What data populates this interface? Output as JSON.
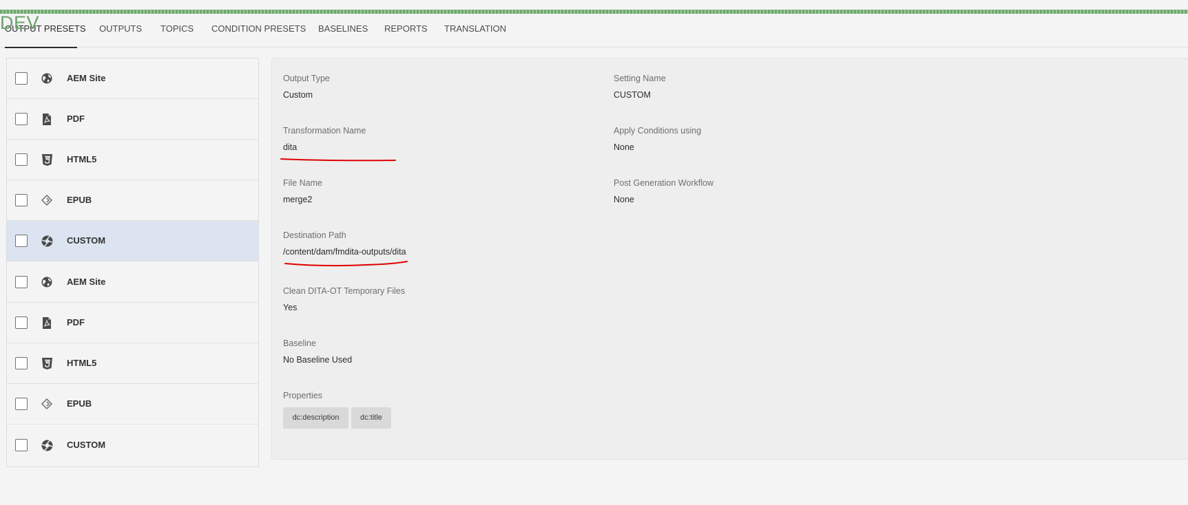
{
  "env_badge": "DEV",
  "tabs": [
    {
      "label": "OUTPUT PRESETS",
      "active": true
    },
    {
      "label": "OUTPUTS"
    },
    {
      "label": "TOPICS"
    },
    {
      "label": "CONDITION PRESETS"
    },
    {
      "label": "BASELINES"
    },
    {
      "label": "REPORTS"
    },
    {
      "label": "TRANSLATION"
    }
  ],
  "presets": [
    {
      "label": "AEM Site",
      "icon": "globe-icon"
    },
    {
      "label": "PDF",
      "icon": "pdf-file-icon"
    },
    {
      "label": "HTML5",
      "icon": "html5-icon"
    },
    {
      "label": "EPUB",
      "icon": "epub-icon"
    },
    {
      "label": "CUSTOM",
      "icon": "aperture-icon",
      "selected": true
    },
    {
      "label": "AEM Site",
      "icon": "globe-icon"
    },
    {
      "label": "PDF",
      "icon": "pdf-file-icon"
    },
    {
      "label": "HTML5",
      "icon": "html5-icon"
    },
    {
      "label": "EPUB",
      "icon": "epub-icon"
    },
    {
      "label": "CUSTOM",
      "icon": "aperture-icon"
    }
  ],
  "details": {
    "output_type": {
      "label": "Output Type",
      "value": "Custom"
    },
    "setting_name": {
      "label": "Setting Name",
      "value": "CUSTOM"
    },
    "transformation_name": {
      "label": "Transformation Name",
      "value": "dita"
    },
    "apply_conditions": {
      "label": "Apply Conditions using",
      "value": "None"
    },
    "file_name": {
      "label": "File Name",
      "value": "merge2"
    },
    "post_generation_workflow": {
      "label": "Post Generation Workflow",
      "value": "None"
    },
    "destination_path": {
      "label": "Destination Path",
      "value": "/content/dam/fmdita-outputs/dita"
    },
    "clean_temp_files": {
      "label": "Clean DITA-OT Temporary Files",
      "value": "Yes"
    },
    "baseline": {
      "label": "Baseline",
      "value": "No Baseline Used"
    },
    "properties": {
      "label": "Properties",
      "tags": [
        "dc:description",
        "dc:title"
      ]
    }
  },
  "colors": {
    "selected_row": "#dbe4f0",
    "env_badge": "#6aa46a",
    "annotation": "#e00000"
  }
}
